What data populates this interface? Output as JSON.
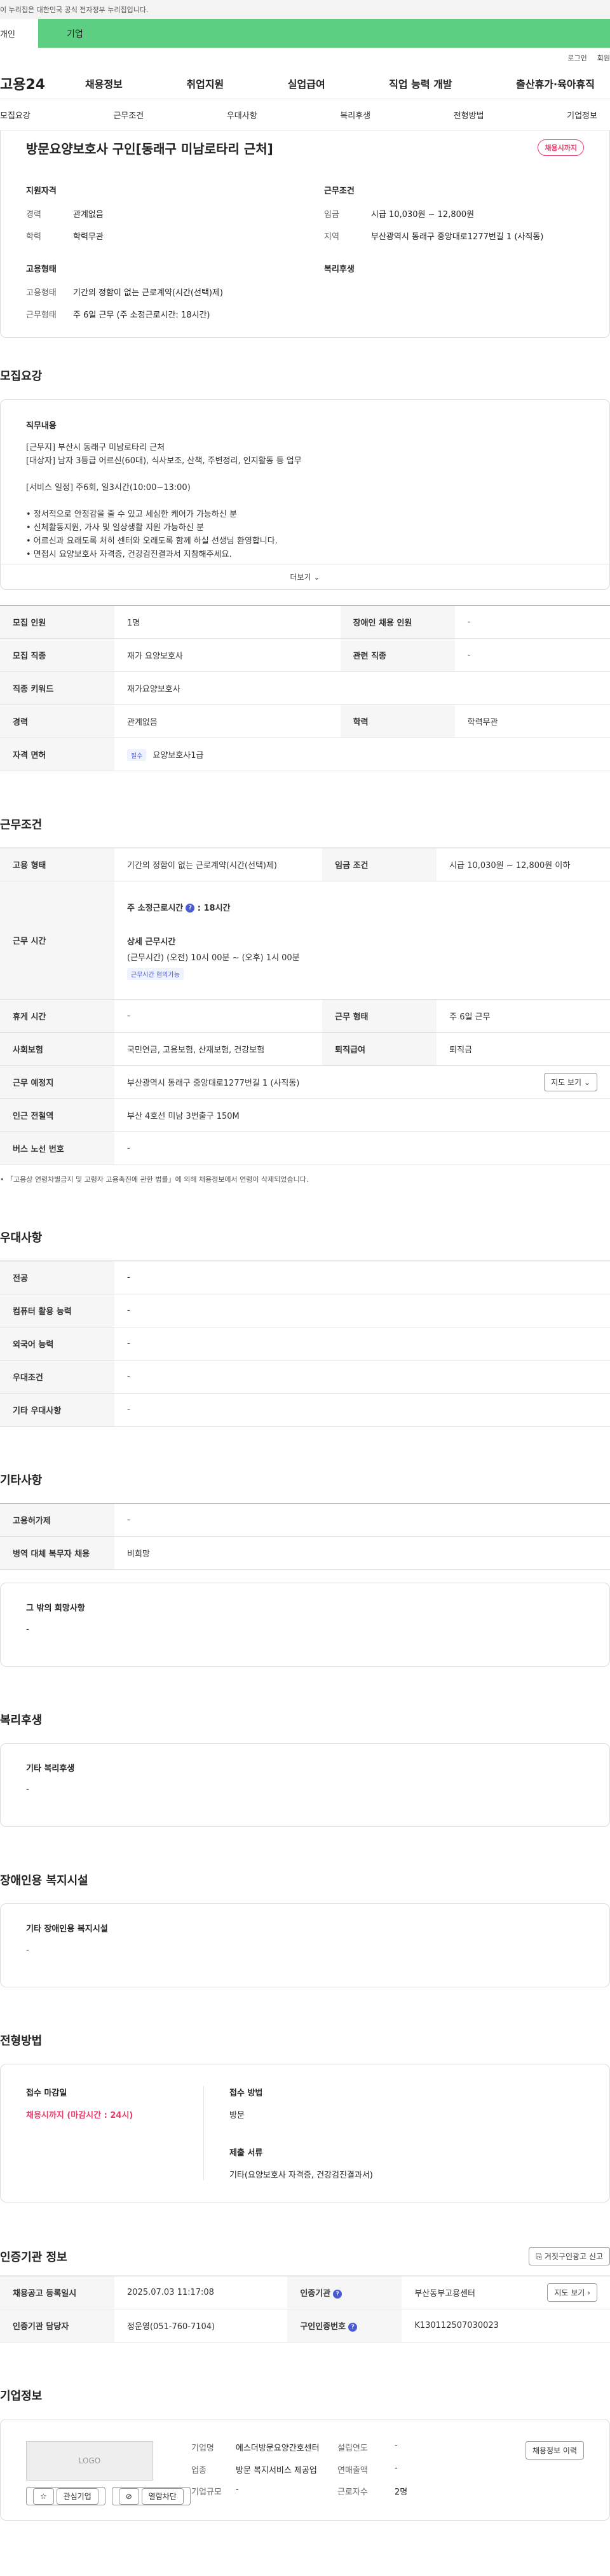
{
  "banner": {
    "text": "이 누리집은 대한민국 공식 전자정부 누리집입니다."
  },
  "persona": {
    "individual": "개인",
    "corporate": "기업"
  },
  "util": {
    "login": "로그인",
    "signup": "회원"
  },
  "gnb": {
    "logo": "고용24",
    "menu": [
      "채용정보",
      "취업지원",
      "실업급여",
      "직업 능력 개발",
      "출산휴가·육아휴직"
    ]
  },
  "tabs": [
    "모집요강",
    "근무조건",
    "우대사항",
    "복리후생",
    "전형방법",
    "기업정보"
  ],
  "job": {
    "title": "방문요양보호사 구인[동래구 미남로타리 근처]",
    "deadline_badge": "채용시까지",
    "qual_title": "지원자격",
    "cond_title": "근무조건",
    "emp_title": "고용형태",
    "welfare_title": "복리후생",
    "career_k": "경력",
    "career_v": "관계없음",
    "edu_k": "학력",
    "edu_v": "학력무관",
    "wage_k": "임금",
    "wage_v": "시급 10,030원 ~ 12,800원",
    "region_k": "지역",
    "region_v": "부산광역시 동래구 중앙대로1277번길 1 (사직동)",
    "emptype_k": "고용형태",
    "emptype_v": "기간의 정함이 없는 근로계약(시간(선택)제)",
    "worktype_k": "근무형태",
    "worktype_v": "주 6일 근무 (주 소정근로시간: 18시간)"
  },
  "recruit": {
    "section_title": "모집요강",
    "desc_title": "직무내용",
    "desc_lines": [
      "[근무지] 부산시 동래구 미남로타리 근처",
      "[대상자] 남자 3등급 어르신(60대), 식사보조, 산책, 주변정리, 인지활동 등 업무",
      "",
      "[서비스 일정] 주6회, 일3시간(10:00~13:00)",
      "",
      "• 정서적으로 안정감을 줄 수 있고 세심한 케어가 가능하신 분",
      "• 신체활동지원, 가사 및 일상생활 지원 가능하신 분",
      "• 어르신과 요래도록 처히 센터와 오래도록 함께 하실 선생님 환영합니다.",
      "• 면접시 요양보호사 자격증, 건강검진결과서 지참해주세요."
    ],
    "more": "더보기",
    "rows": [
      {
        "k1": "모집 인원",
        "v1": "1명",
        "k2": "장애인 채용 인원",
        "v2": "-"
      },
      {
        "k1": "모집 직종",
        "v1": "재가 요양보호사",
        "k2": "관련 직종",
        "v2": "-"
      },
      {
        "k1": "직종 키워드",
        "v1": "재가요양보호사"
      },
      {
        "k1": "경력",
        "v1": "관계없음",
        "k2": "학력",
        "v2": "학력무관"
      }
    ],
    "license_k": "자격 면허",
    "license_tag": "필수",
    "license_v": "요양보호사1급"
  },
  "conditions": {
    "section_title": "근무조건",
    "emp_k": "고용 형태",
    "emp_v": "기간의 정함이 없는 근로계약(시간(선택)제)",
    "wage_k": "임금 조건",
    "wage_v": "시급 10,030원 ~ 12,800원 이하",
    "hours_k": "근무 시간",
    "hours_weekly": "주 소정근로시간",
    "hours_weekly_v": ": 18시간",
    "hours_detail_title": "상세 근무시간",
    "hours_detail_v": "(근무시간) (오전) 10시 00분 ~ (오후) 1시 00분",
    "hours_tag": "근무시간 협의가능",
    "rest_k": "휴게 시간",
    "rest_v": "-",
    "form_k": "근무 형태",
    "form_v": "주 6일 근무",
    "insurance_k": "사회보험",
    "insurance_v": "국민연금, 고용보험, 산재보험, 건강보험",
    "retire_k": "퇴직급여",
    "retire_v": "퇴직금",
    "place_k": "근무 예정지",
    "place_v": "부산광역시 동래구 중앙대로1277번길 1 (사직동)",
    "map_btn": "지도 보기",
    "station_k": "인근 전철역",
    "station_v": "부산 4호선 미남 3번출구 150M",
    "bus_k": "버스 노선 번호",
    "bus_v": "-",
    "note": "• 「고용상 연령차별금지 및 고령자 고용촉진에 관한 법률」에 의해 채용정보에서 연령이 삭제되었습니다."
  },
  "preference": {
    "section_title": "우대사항",
    "rows": [
      {
        "k": "전공",
        "v": "-"
      },
      {
        "k": "컴퓨터 활용 능력",
        "v": "-"
      },
      {
        "k": "외국어 능력",
        "v": "-"
      },
      {
        "k": "우대조건",
        "v": "-"
      },
      {
        "k": "기타 우대사항",
        "v": "-"
      }
    ]
  },
  "other": {
    "section_title": "기타사항",
    "rows": [
      {
        "k": "고용허가제",
        "v": "-"
      },
      {
        "k": "병역 대체 복무자 채용",
        "v": "비희망"
      }
    ],
    "extra_title": "그 밖의 희망사항",
    "extra_v": "-"
  },
  "welfare": {
    "section_title": "복리후생",
    "title": "기타 복리후생",
    "v": "-"
  },
  "disability": {
    "section_title": "장애인용 복지시설",
    "title": "기타 장애인용 복지시설",
    "v": "-"
  },
  "apply": {
    "section_title": "전형방법",
    "deadline_title": "접수 마감일",
    "deadline_v": "채용시까지 (마감시간 : 24시)",
    "method_title": "접수 방법",
    "method_v": "방문",
    "docs_title": "제출 서류",
    "docs_v": "기타(요양보호사 자격증, 건강검진결과서)"
  },
  "agency": {
    "section_title": "인증기관 정보",
    "report_btn": "거짓구인광고 신고",
    "reg_k": "채용공고 등록일시",
    "reg_v": "2025.07.03 11:17:08",
    "cert_k": "인증기관",
    "cert_v": "부산동부고용센터",
    "map_btn": "지도 보기",
    "manager_k": "인증기관 담당자",
    "manager_v": "정운영(051-760-7104)",
    "jobno_k": "구인인증번호",
    "jobno_v": "K130112507030023"
  },
  "company": {
    "section_title": "기업정보",
    "logo": "LOGO",
    "fav_btn": "관심기업",
    "block_btn": "열람차단",
    "history_btn": "채용정보 이력",
    "name_k": "기업명",
    "name_v": "에스더방문요양간호센터",
    "year_k": "설립연도",
    "year_v": "-",
    "industry_k": "업종",
    "industry_v": "방문 복지서비스 제공업",
    "sales_k": "연매출액",
    "sales_v": "-",
    "employees_k": "근로자수",
    "employees_v": "2명",
    "size_k": "기업규모",
    "size_v": "-"
  }
}
